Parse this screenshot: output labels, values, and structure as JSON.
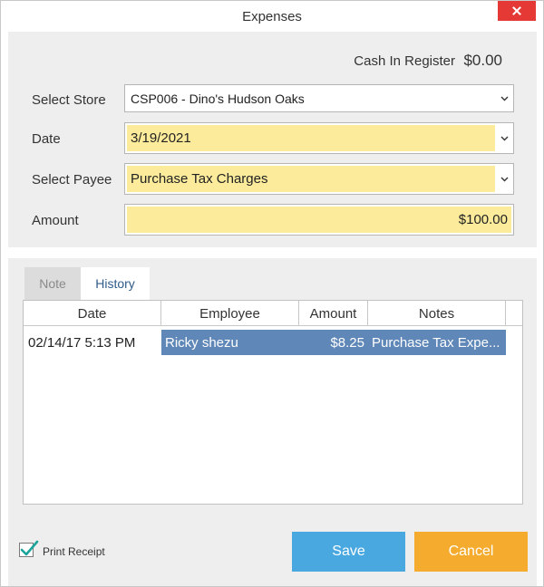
{
  "window": {
    "title": "Expenses",
    "close_icon": "close-icon"
  },
  "form": {
    "cash_label": "Cash In Register",
    "cash_value": "$0.00",
    "store": {
      "label": "Select Store",
      "value": "CSP006 - Dino's Hudson Oaks"
    },
    "date": {
      "label": "Date",
      "value": "3/19/2021"
    },
    "payee": {
      "label": "Select Payee",
      "value": "Purchase Tax Charges"
    },
    "amount": {
      "label": "Amount",
      "value": "$100.00"
    }
  },
  "tabs": [
    {
      "label": "Note",
      "active": false
    },
    {
      "label": "History",
      "active": true
    }
  ],
  "history": {
    "columns": [
      "Date",
      "Employee",
      "Amount",
      "Notes"
    ],
    "rows": [
      {
        "date": "02/14/17 5:13 PM",
        "employee": "Ricky shezu",
        "amount": "$8.25",
        "notes": "Purchase Tax Expe..."
      }
    ]
  },
  "footer": {
    "print_receipt": {
      "label": "Print Receipt",
      "checked": true
    },
    "save_label": "Save",
    "cancel_label": "Cancel"
  },
  "colors": {
    "highlight_yellow": "#fbeb9b",
    "selected_row": "#5f87b8",
    "save_button": "#4aa8e0",
    "cancel_button": "#f4ab2e",
    "close_button": "#e53935",
    "check_teal": "#1aa39a"
  }
}
